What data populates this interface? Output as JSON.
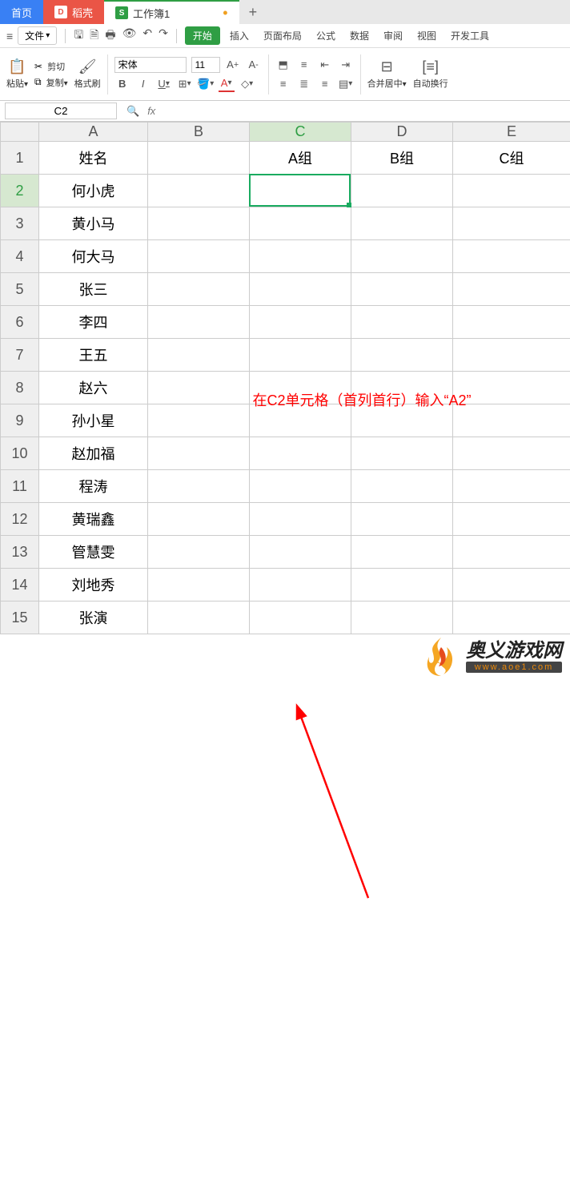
{
  "tabs": {
    "home": "首页",
    "doker": "稻壳",
    "workbook": "工作簿1",
    "plus": "+"
  },
  "menubar": {
    "file": "文件",
    "start": "开始",
    "items": [
      "插入",
      "页面布局",
      "公式",
      "数据",
      "审阅",
      "视图",
      "开发工具"
    ]
  },
  "ribbon": {
    "paste": "粘贴",
    "cut": "剪切",
    "copy": "复制",
    "format_painter": "格式刷",
    "font_name": "宋体",
    "font_size": "11",
    "merge_center": "合并居中",
    "wrap": "自动换行"
  },
  "fxbar": {
    "cell_ref": "C2",
    "fx": "fx"
  },
  "columns": [
    "A",
    "B",
    "C",
    "D",
    "E"
  ],
  "colA": [
    "姓名",
    "何小虎",
    "黄小马",
    "何大马",
    "张三",
    "李四",
    "王五",
    "赵六",
    "孙小星",
    "赵加福",
    "程涛",
    "黄瑞鑫",
    "管慧雯",
    "刘地秀",
    "张演"
  ],
  "row1": {
    "C": "A组",
    "D": "B组",
    "E": "C组"
  },
  "annotation": "在C2单元格（首列首行）输入“A2”",
  "watermark": {
    "title": "奥义游戏网",
    "url": "www.aoe1.com"
  },
  "colors": {
    "tab_home": "#3980f4",
    "tab_doker": "#ea5546",
    "accent": "#2f9e44",
    "selection": "#1aab60",
    "annot": "#ff0000",
    "flame1": "#f5a623",
    "flame2": "#e54b1d"
  }
}
